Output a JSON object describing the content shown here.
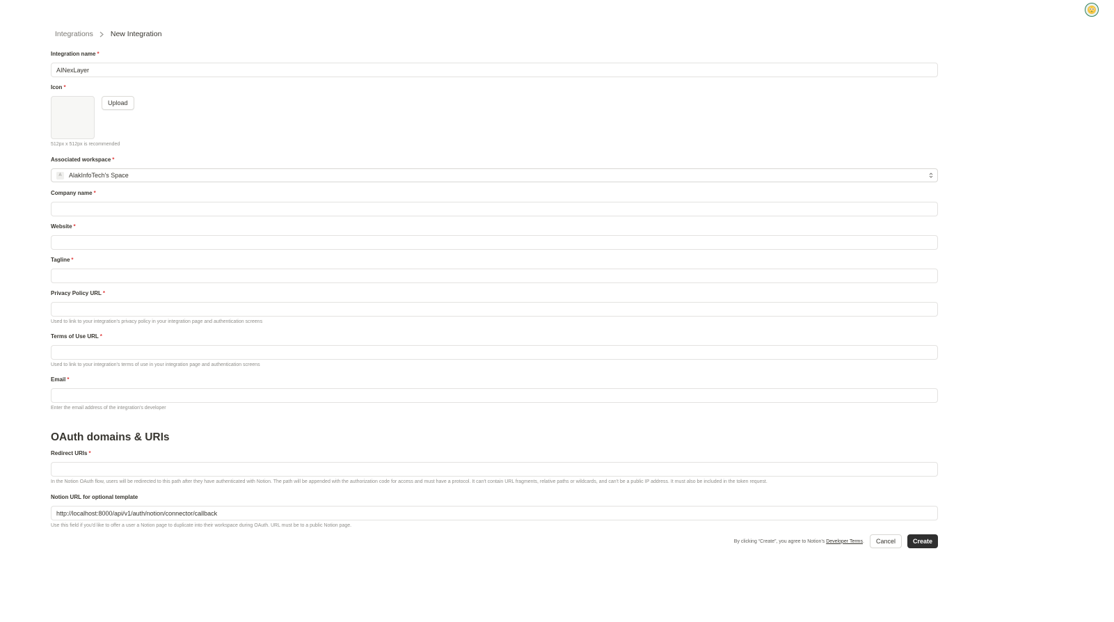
{
  "breadcrumb": {
    "parent": "Integrations",
    "current": "New Integration"
  },
  "form": {
    "integration_name": {
      "label": "Integration name",
      "required": "*",
      "value": "AINexLayer",
      "placeholder": ""
    },
    "icon": {
      "label": "Icon",
      "required": "*",
      "upload_label": "Upload",
      "hint": "512px x 512px is recommended"
    },
    "workspace": {
      "label": "Associated workspace",
      "required": "*",
      "avatar_letter": "A",
      "value": "AlakInfoTech's Space"
    },
    "company_name": {
      "label": "Company name",
      "required": "*",
      "value": ""
    },
    "website": {
      "label": "Website",
      "required": "*",
      "value": ""
    },
    "tagline": {
      "label": "Tagline",
      "required": "*",
      "value": ""
    },
    "privacy_url": {
      "label": "Privacy Policy URL",
      "required": "*",
      "value": "",
      "hint": "Used to link to your integration's privacy policy in your integration page and authentication screens"
    },
    "terms_url": {
      "label": "Terms of Use URL",
      "required": "*",
      "value": "",
      "hint": "Used to link to your integration's terms of use in your integration page and authentication screens"
    },
    "email": {
      "label": "Email",
      "required": "*",
      "value": "",
      "hint": "Enter the email address of the integration's developer"
    }
  },
  "oauth": {
    "title": "OAuth domains & URIs",
    "redirect_uris": {
      "label": "Redirect URIs",
      "required": "*",
      "value": "",
      "hint": "In the Notion OAuth flow, users will be redirected to this path after they have authenticated with Notion. The path will be appended with the authorization code for access and must have a protocol. It can't contain URL fragments, relative paths or wildcards, and can't be a public IP address. It must also be included in the token request."
    },
    "template_url": {
      "label": "Notion URL for optional template",
      "value": "http://localhost:8000/api/v1/auth/notion/connector/callback",
      "hint": "Use this field if you'd like to offer a user a Notion page to duplicate into their workspace during OAuth. URL must be to a public Notion page."
    }
  },
  "footer": {
    "terms_prefix": "By clicking “Create”, you agree to Notion's ",
    "terms_link": "Developer Terms",
    "terms_suffix": ".",
    "cancel_label": "Cancel",
    "create_label": "Create"
  },
  "colors": {
    "required": "#e03e3e",
    "primary_button": "#2f2f2f",
    "border": "#e3e2e0",
    "avatar_ring": "#2f7d5b"
  }
}
